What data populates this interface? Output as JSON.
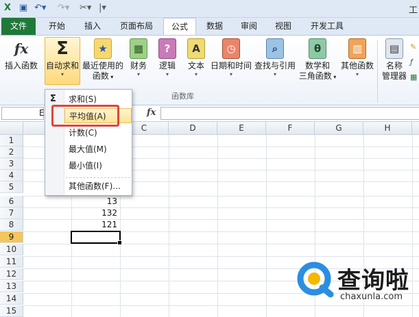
{
  "qat": {
    "title": "工"
  },
  "tabs": [
    "文件",
    "开始",
    "插入",
    "页面布局",
    "公式",
    "数据",
    "审阅",
    "视图",
    "开发工具"
  ],
  "ribbon": {
    "insert_function": "插入函数",
    "autosum": "自动求和",
    "recent": [
      "最近使用的",
      "函数"
    ],
    "financial": "财务",
    "logical": "逻辑",
    "text": "文本",
    "datetime": "日期和时间",
    "lookup": "查找与引用",
    "math": [
      "数学和",
      "三角函数"
    ],
    "more": "其他函数",
    "name_manager": [
      "名称",
      "管理器"
    ],
    "group_label": "函数库"
  },
  "formula_bar": {
    "name_box": "E",
    "fx": "fx"
  },
  "columns": [
    "C",
    "D",
    "E",
    "F",
    "G",
    "H"
  ],
  "rows": [
    "1",
    "2",
    "3",
    "4",
    "5",
    "6",
    "7",
    "8",
    "9",
    "10",
    "11",
    "12",
    "13",
    "14",
    "15"
  ],
  "cells": {
    "b6": "13",
    "b7": "132",
    "b8": "121"
  },
  "menu": {
    "items": [
      "求和(S)",
      "平均值(A)",
      "计数(C)",
      "最大值(M)",
      "最小值(I)",
      "其他函数(F)..."
    ]
  },
  "watermark": {
    "text": "查询啦",
    "url": "chaxunla.com"
  },
  "colors": {
    "accent": "#1f7a3a",
    "highlight": "#e0453b",
    "selected_row": "#f5c65b"
  }
}
